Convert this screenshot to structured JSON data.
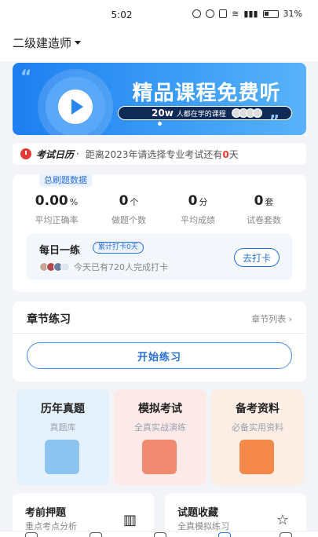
{
  "status": {
    "time": "5:02",
    "battery": "31%"
  },
  "header": {
    "exam_selector": "二级建造师"
  },
  "banner": {
    "title": "精品课程免费听",
    "pill_count": "20w",
    "pill_text": "人都在学的课程",
    "accent": "#1d7ff0"
  },
  "calendar": {
    "title": "考试日历",
    "text_before": "距离2023年请选择专业考试还有",
    "days": "0",
    "text_after": "天"
  },
  "stats": {
    "tag": "总刷题数据",
    "items": [
      {
        "value": "0.00",
        "unit": "%",
        "label": "平均正确率"
      },
      {
        "value": "0",
        "unit": "个",
        "label": "做题个数"
      },
      {
        "value": "0",
        "unit": "分",
        "label": "平均成绩"
      },
      {
        "value": "0",
        "unit": "套",
        "label": "试卷套数"
      }
    ]
  },
  "daily": {
    "title": "每日一练",
    "streak": "累计打卡0天",
    "people_text": "今天已有720人完成打卡",
    "checkin_button": "去打卡"
  },
  "chapter": {
    "title": "章节练习",
    "list_link": "章节列表",
    "start_button": "开始练习"
  },
  "tiles": [
    {
      "title": "历年真题",
      "subtitle": "真题库",
      "bg": "#e5f1fb",
      "art": "#8cc3ef"
    },
    {
      "title": "模拟考试",
      "subtitle": "全真实战演练",
      "bg": "#fce9e8",
      "art": "#f08a70"
    },
    {
      "title": "备考资料",
      "subtitle": "必备实用资料",
      "bg": "#fdeee5",
      "art": "#f5894a"
    }
  ],
  "bottom": [
    {
      "title": "考前押题",
      "subtitle": "重点考点分析",
      "icon": "book-icon"
    },
    {
      "title": "试题收藏",
      "subtitle": "全真模拟练习",
      "icon": "star-icon"
    }
  ]
}
